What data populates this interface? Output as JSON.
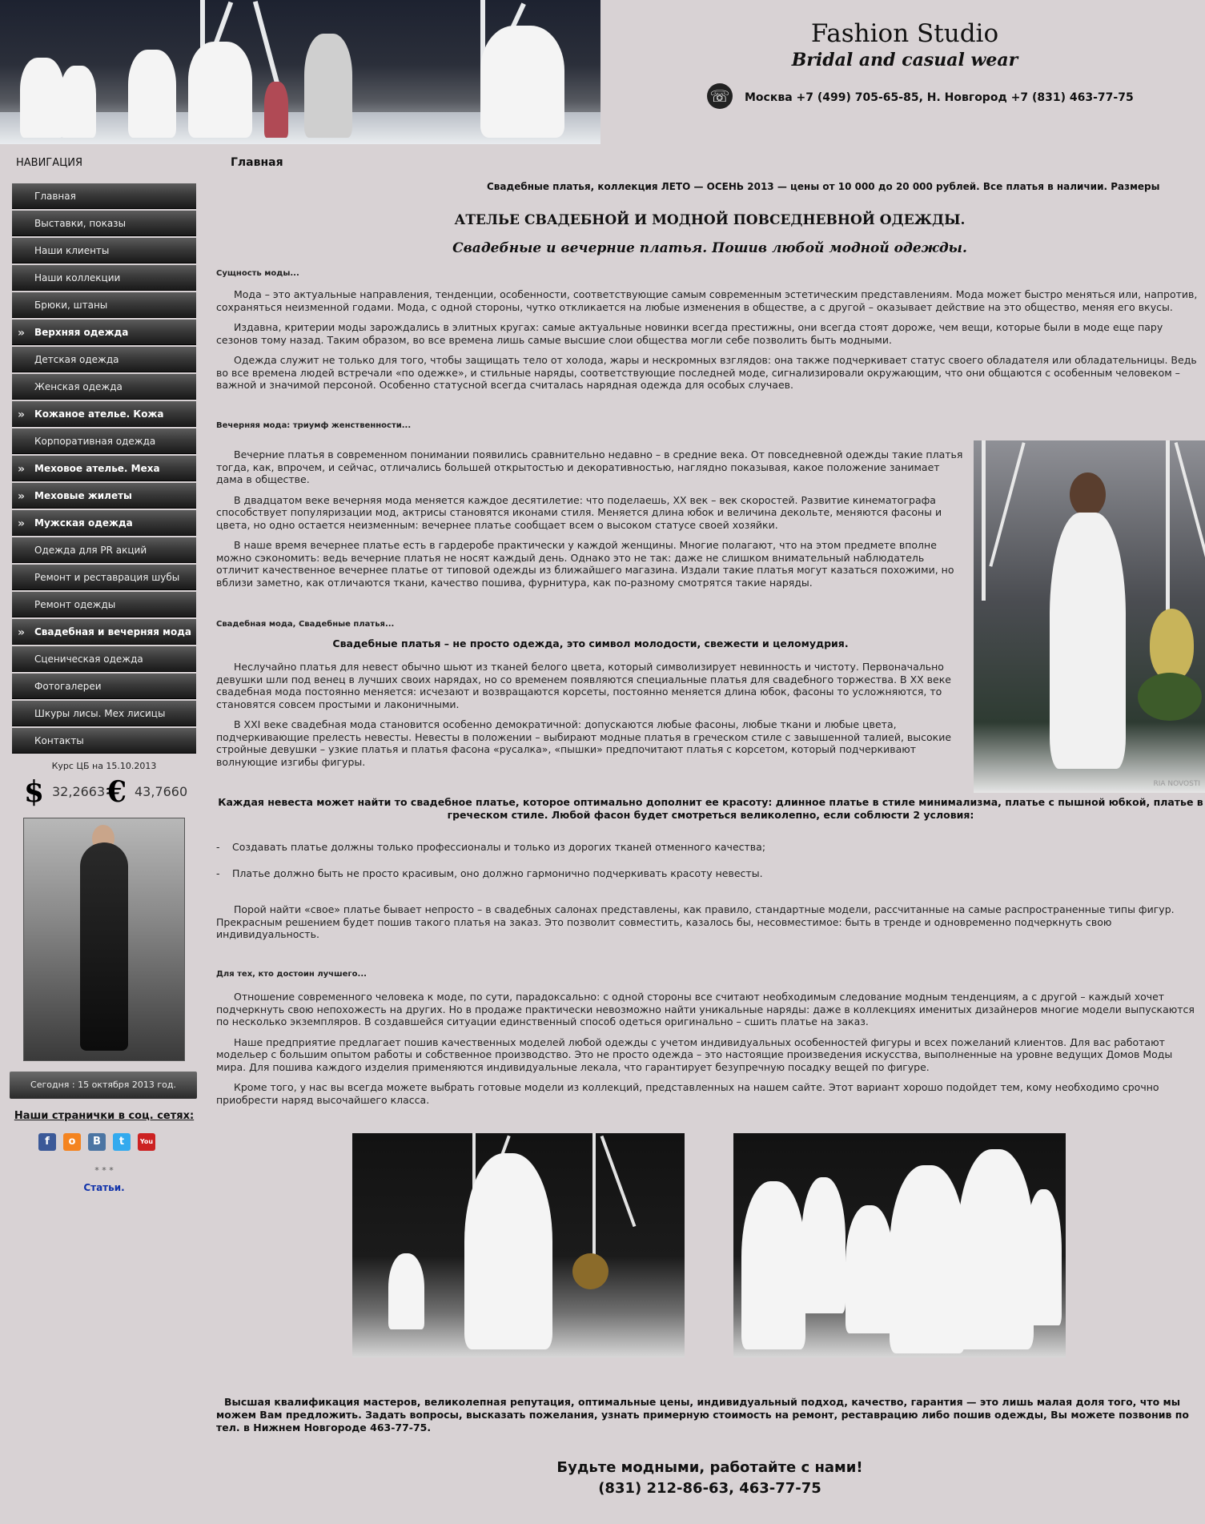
{
  "header": {
    "title": "Fashion Studio",
    "subtitle": "Bridal and casual wear",
    "phones": "Москва +7 (499) 705-65-85, Н. Новгород +7 (831) 463-77-75"
  },
  "sidebar": {
    "nav_title": "НАВИГАЦИЯ",
    "items": [
      {
        "label": "Главная",
        "bold": false
      },
      {
        "label": "Выставки, показы",
        "bold": false
      },
      {
        "label": "Наши клиенты",
        "bold": false
      },
      {
        "label": "Наши коллекции",
        "bold": false
      },
      {
        "label": "Брюки, штаны",
        "bold": false
      },
      {
        "label": "Верхняя одежда",
        "bold": true
      },
      {
        "label": "Детская одежда",
        "bold": false
      },
      {
        "label": "Женская одежда",
        "bold": false
      },
      {
        "label": "Кожаное ателье. Кожа",
        "bold": true
      },
      {
        "label": "Корпоративная одежда",
        "bold": false
      },
      {
        "label": "Меховое ателье. Меха",
        "bold": true
      },
      {
        "label": "Меховые жилеты",
        "bold": true
      },
      {
        "label": "Мужская одежда",
        "bold": true
      },
      {
        "label": "Одежда для PR акций",
        "bold": false
      },
      {
        "label": "Ремонт и реставрация шубы",
        "bold": false
      },
      {
        "label": "Ремонт одежды",
        "bold": false
      },
      {
        "label": "Свадебная и вечерняя мода",
        "bold": true
      },
      {
        "label": "Сценическая одежда",
        "bold": false
      },
      {
        "label": "Фотогалереи",
        "bold": false
      },
      {
        "label": "Шкуры лисы. Мех лисицы",
        "bold": false
      },
      {
        "label": "Контакты",
        "bold": false
      }
    ],
    "bullet": "»",
    "rates": {
      "title": "Курс ЦБ на 15.10.2013",
      "usd_symbol": "$",
      "usd_value": "32,2663",
      "eur_symbol": "€",
      "eur_value": "43,7660"
    },
    "today": "Сегодня :  15 октября 2013 год.",
    "social_title": "Наши странички в соц. сетях:",
    "social": [
      {
        "icon": "facebook-icon",
        "glyph": "f",
        "color": "#3b5998"
      },
      {
        "icon": "odnoklassniki-icon",
        "glyph": "о",
        "color": "#f48420"
      },
      {
        "icon": "vkontakte-icon",
        "glyph": "B",
        "color": "#4c75a3"
      },
      {
        "icon": "twitter-icon",
        "glyph": "t",
        "color": "#33aaee"
      },
      {
        "icon": "youtube-icon",
        "glyph": "You",
        "color": "#cc2222"
      }
    ],
    "stars": "* * *",
    "articles_link": "Статьи."
  },
  "main": {
    "breadcrumb": "Главная",
    "marquee": "Свадебные платья, коллекция ЛЕТО — ОСЕНЬ 2013 — цены от 10 000 до 20 000 рублей. Все платья в наличии. Размеры",
    "heading": "АТЕЛЬЕ СВАДЕБНОЙ И МОДНОЙ ПОВСЕДНЕВНОЙ ОДЕЖДЫ.",
    "subheading": "Свадебные и вечерние платья. Пошив любой модной одежды.",
    "section1": {
      "title": "Сущность моды...",
      "paragraphs": [
        "Мода – это актуальные направления, тенденции, особенности, соответствующие самым современным эстетическим представлениям. Мода может быстро меняться или, напротив, сохраняться неизменной годами. Мода, с одной стороны, чутко откликается на любые изменения в обществе, а с другой – оказывает действие на это общество, меняя его вкусы.",
        "Издавна, критерии моды зарождались в элитных кругах: самые актуальные новинки всегда престижны, они всегда стоят дороже, чем вещи, которые были в моде еще пару сезонов тому назад. Таким образом, во все времена лишь самые высшие слои общества могли себе позволить быть модными.",
        "Одежда служит не только для того, чтобы защищать тело от холода, жары и нескромных взглядов: она также подчеркивает статус своего обладателя или обладательницы. Ведь во все времена людей встречали «по одежке», и стильные наряды, соответствующие последней моде, сигнализировали окружающим, что они общаются с особенным человеком – важной и значимой персоной. Особенно статусной всегда считалась нарядная одежда для особых случаев."
      ]
    },
    "section2": {
      "title": "Вечерняя мода: триумф женственности...",
      "paragraphs": [
        "Вечерние платья в современном понимании появились сравнительно недавно – в средние века. От повседневной одежды такие платья тогда, как, впрочем, и сейчас, отличались большей открытостью и декоративностью, наглядно показывая, какое положение занимает дама в обществе.",
        "В двадцатом веке вечерняя мода меняется каждое десятилетие: что поделаешь, XX век – век скоростей. Развитие кинематографа способствует популяризации мод, актрисы становятся иконами стиля. Меняется длина юбок и величина декольте, меняются фасоны и цвета, но одно остается неизменным: вечернее платье сообщает всем о высоком статусе своей хозяйки.",
        "В наше время вечернее платье есть в гардеробе практически у каждой женщины. Многие полагают, что на этом предмете вполне можно сэкономить: ведь вечерние платья не носят каждый день. Однако это не так: даже не слишком внимательный наблюдатель отличит качественное вечернее платье от типовой одежды из ближайшего магазина. Издали такие платья могут казаться похожими, но вблизи заметно, как отличаются ткани, качество пошива, фурнитура, как по-разному смотрятся такие наряды."
      ]
    },
    "section3": {
      "title": "Свадебная мода, Свадебные платья...",
      "subtitle": "Свадебные платья – не просто одежда, это символ молодости, свежести и целомудрия.",
      "paragraphs": [
        "Неслучайно платья для невест обычно шьют из тканей белого цвета, который символизирует невинность и чистоту. Первоначально девушки шли под венец в лучших своих нарядах, но со временем появляются специальные платья для свадебного торжества. В XX веке свадебная мода постоянно меняется: исчезают и возвращаются корсеты, постоянно меняется длина юбок, фасоны то усложняются, то становятся совсем простыми и лаконичными.",
        "В XXI веке свадебная мода становится особенно демократичной: допускаются любые фасоны, любые ткани и любые цвета, подчеркивающие прелесть невесты. Невесты в положении – выбирают модные платья в греческом стиле с завышенной талией, высокие стройные девушки – узкие платья и платья фасона «русалка», «пышки» предпочитают платья с корсетом, который подчеркивают волнующие изгибы фигуры."
      ],
      "photo_watermark": "RIA NOVOSTI"
    },
    "callout": "Каждая невеста может найти то свадебное платье, которое оптимально дополнит ее красоту: длинное платье в стиле минимализма, платье с пышной юбкой, платье в греческом стиле. Любой фасон будет смотреться великолепно, если соблюсти 2 условия:",
    "bullets": [
      "Создавать платье должны только профессионалы и только из дорогих тканей отменного качества;",
      "Платье должно быть не просто красивым, оно должно гармонично подчеркивать красоту невесты."
    ],
    "section4": {
      "paragraphs": [
        "Порой найти «свое» платье бывает непросто – в свадебных салонах представлены, как правило, стандартные модели, рассчитанные на самые распространенные типы фигур. Прекрасным решением будет пошив такого платья на заказ. Это позволит совместить, казалось бы, несовместимое: быть в тренде и одновременно подчеркнуть свою индивидуальность."
      ]
    },
    "section5": {
      "title": "Для тех, кто достоин лучшего...",
      "paragraphs": [
        "Отношение современного человека к моде, по сути, парадоксально: с одной стороны все считают необходимым следование модным тенденциям, а с другой – каждый хочет подчеркнуть свою непохожесть на других. Но в продаже практически невозможно найти уникальные наряды: даже в коллекциях именитых дизайнеров многие модели выпускаются по несколько экземпляров. В создавшейся ситуации единственный способ одеться оригинально – сшить платье на заказ.",
        "Наше предприятие предлагает пошив качественных моделей любой одежды с учетом индивидуальных особенностей фигуры и всех пожеланий клиентов. Для вас работают модельер с большим опытом работы и собственное производство. Это не просто одежда – это настоящие произведения искусства, выполненные на уровне ведущих Домов Моды мира. Для пошива каждого изделия применяются индивидуальные лекала, что гарантирует безупречную посадку вещей по фигуре.",
        "Кроме того, у нас вы всегда можете выбрать готовые модели из коллекций, представленных на нашем сайте. Этот вариант хорошо подойдет тем, кому необходимо срочно приобрести наряд высочайшего класса."
      ]
    },
    "closing": "Высшая квалификация мастеров, великолепная репутация, оптимальные цены, индивидуальный подход, качество, гарантия — это лишь малая доля того, что мы можем Вам предложить. Задать вопросы, высказать пожелания, узнать примерную стоимость на ремонт, реставрацию либо пошив одежды, Вы можете позвонив  по тел. в Нижнем Новгороде 463-77-75.",
    "cta_title": "Будьте модными, работайте с нами!",
    "cta_phone": "(831) 212-86-63, 463-77-75"
  }
}
